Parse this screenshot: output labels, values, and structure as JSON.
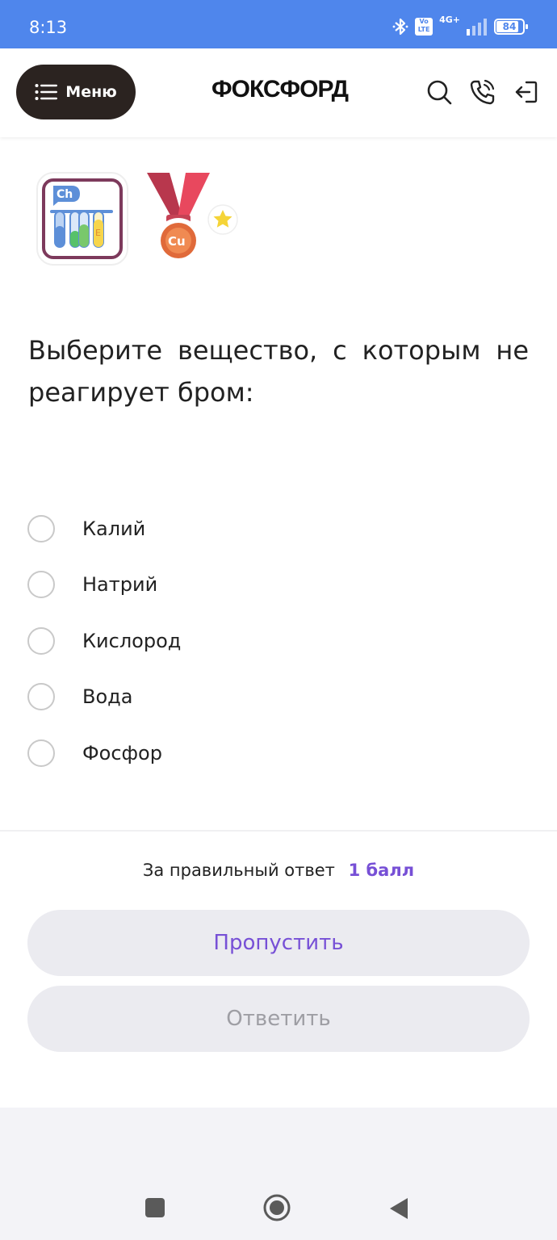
{
  "status_bar": {
    "time": "8:13",
    "network": "4G+",
    "volte": "Vo LTE",
    "battery": "84",
    "battery_fraction": 0.84
  },
  "header": {
    "menu_label": "Меню",
    "logo": "ФОКСФОРД"
  },
  "badges": {
    "chem_label": "Ch",
    "medal_label": "Cu"
  },
  "question": {
    "text": "Выберите вещество, с которым не реагирует бром:"
  },
  "options": [
    {
      "label": "Калий",
      "selected": false
    },
    {
      "label": "Натрий",
      "selected": false
    },
    {
      "label": "Кислород",
      "selected": false
    },
    {
      "label": "Вода",
      "selected": false
    },
    {
      "label": "Фосфор",
      "selected": false
    }
  ],
  "footer": {
    "reward_text": "За правильный ответ",
    "reward_points": "1 балл",
    "skip_label": "Пропустить",
    "answer_label": "Ответить"
  },
  "colors": {
    "accent": "#7750d6",
    "status_bar": "#4f86ec",
    "menu_button": "#2b2320",
    "button_bg": "#ebebf0"
  }
}
